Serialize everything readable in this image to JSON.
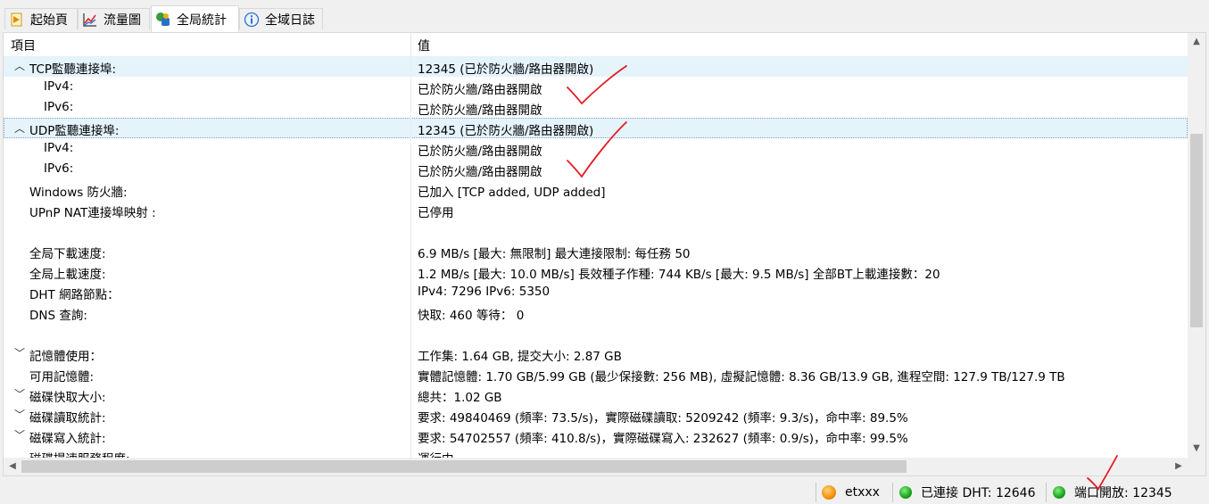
{
  "tabs": [
    {
      "label": "起始頁",
      "icon": "start-page-icon"
    },
    {
      "label": "流量圖",
      "icon": "traffic-graph-icon"
    },
    {
      "label": "全局統計",
      "icon": "global-stats-icon"
    },
    {
      "label": "全域日誌",
      "icon": "log-info-icon"
    }
  ],
  "table": {
    "headers": {
      "item": "項目",
      "value": "值"
    },
    "rows": [
      {
        "label": "TCP監聽連接埠:",
        "value": "12345 (已於防火牆/路由器開啟)",
        "chevron": "up"
      },
      {
        "label": "IPv4:",
        "value": "已於防火牆/路由器開啟"
      },
      {
        "label": "IPv6:",
        "value": "已於防火牆/路由器開啟"
      },
      {
        "label": "UDP監聽連接埠:",
        "value": "12345 (已於防火牆/路由器開啟)",
        "chevron": "up"
      },
      {
        "label": "IPv4:",
        "value": "已於防火牆/路由器開啟"
      },
      {
        "label": "IPv6:",
        "value": "已於防火牆/路由器開啟"
      },
      {
        "label": "Windows 防火牆:",
        "value": "已加入 [TCP added, UDP added]"
      },
      {
        "label": "UPnP NAT連接埠映射 :",
        "value": "已停用"
      },
      {
        "label": "",
        "value": ""
      },
      {
        "label": "全局下載速度:",
        "value": "6.9 MB/s [最大: 無限制]     最大連接限制: 每任務 50"
      },
      {
        "label": "全局上載速度:",
        "value": "1.2 MB/s [最大: 10.0 MB/s]     長效種子作種: 744 KB/s [最大: 9.5 MB/s]     全部BT上載連接數：20"
      },
      {
        "label": "DHT 網路節點：",
        "value": "IPv4: 7296  IPv6: 5350"
      },
      {
        "label": "DNS 查詢:",
        "value": "快取: 460   等待： 0"
      },
      {
        "label": "",
        "value": ""
      },
      {
        "label": "記憶體使用：",
        "value": "工作集: 1.64 GB, 提交大小: 2.87 GB",
        "chevron": "down"
      },
      {
        "label": "可用記憶體:",
        "value": "實體記憶體: 1.70 GB/5.99 GB (最少保接數: 256 MB), 虛擬記憶體: 8.36 GB/13.9 GB, 進程空間: 127.9 TB/127.9 TB"
      },
      {
        "label": "磁碟快取大小:",
        "value": "總共：1.02 GB",
        "chevron": "down"
      },
      {
        "label": "磁碟讀取統計:",
        "value": "要求: 49840469 (頻率: 73.5/s)，實際磁碟讀取: 5209242 (頻率: 9.3/s)，命中率: 89.5%",
        "chevron": "down"
      },
      {
        "label": "磁碟寫入統計:",
        "value": "要求: 54702557 (頻率: 410.8/s)，實際磁碟寫入: 232627 (頻率: 0.9/s)，命中率: 99.5%",
        "chevron": "down"
      },
      {
        "label": "磁碟提速服務程度:",
        "value": "運行中"
      }
    ]
  },
  "statusbar": {
    "user": "etxxx",
    "dht": "已連接 DHT: 12646",
    "port": "端口開放: 12345"
  },
  "colors": {
    "row_highlight": "#e5f3fb",
    "annotation_marks": "#e31b23",
    "status_ok": "#1aa31a"
  }
}
